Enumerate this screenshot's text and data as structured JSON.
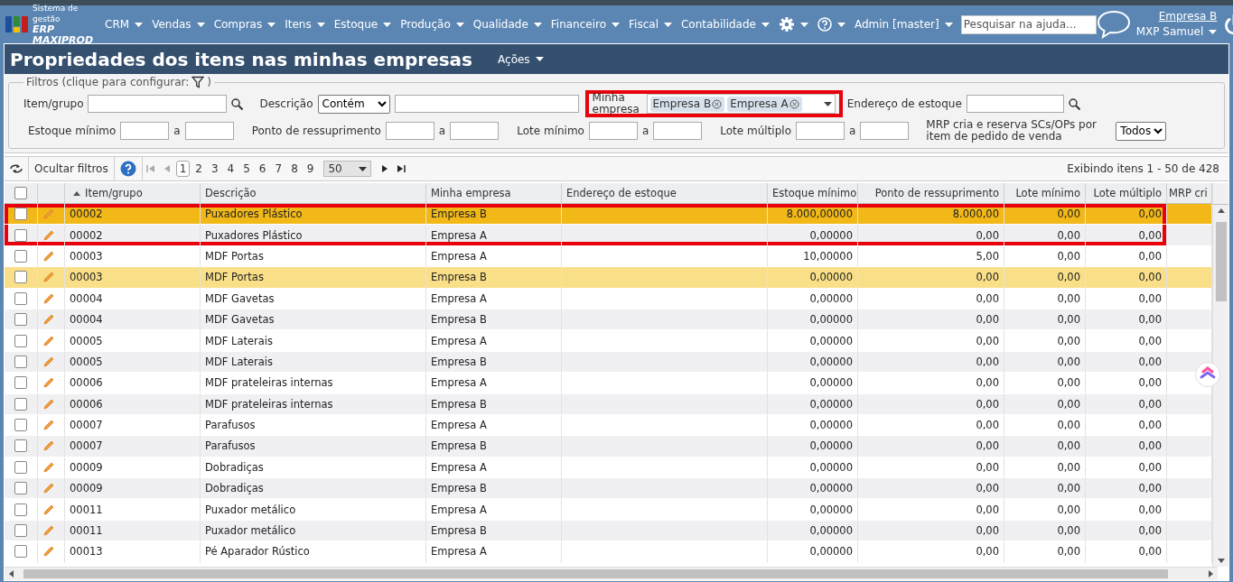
{
  "nav": {
    "logo_line1": "Sistema de gestão",
    "logo_line2": "ERP MAXIPROD",
    "menus": [
      "CRM",
      "Vendas",
      "Compras",
      "Itens",
      "Estoque",
      "Produção",
      "Qualidade",
      "Financeiro",
      "Fiscal",
      "Contabilidade"
    ],
    "user_menu": "Admin [master]",
    "help_search": {
      "placeholder": "Pesquisar na ajuda..."
    },
    "company_link": "Empresa B",
    "user_name": "MXP Samuel"
  },
  "page": {
    "title": "Propriedades dos itens nas minhas empresas",
    "actions": "Ações"
  },
  "filters": {
    "legend": "Filtros (clique para configurar:",
    "legend_end": ")",
    "item_label": "Item/grupo",
    "description_label": "Descrição",
    "description_mode": "Contém",
    "company_label": "Minha empresa",
    "company_tags": [
      "Empresa B",
      "Empresa A"
    ],
    "company_outlined": true,
    "stock_address_label": "Endereço de estoque",
    "ranges": [
      {
        "label": "Estoque mínimo",
        "to": "a"
      },
      {
        "label": "Ponto de ressuprimento",
        "to": "a"
      },
      {
        "label": "Lote mínimo",
        "to": "a"
      },
      {
        "label": "Lote múltiplo",
        "to": "a"
      }
    ],
    "mrp_label": "MRP cria e reserva SCs/OPs por item de pedido de venda",
    "mrp_value": "Todos"
  },
  "toolbar": {
    "hide_filters": "Ocultar filtros",
    "pages": [
      {
        "label": "1",
        "selected": true
      },
      {
        "label": "2",
        "selected": false
      },
      {
        "label": "3",
        "selected": false
      },
      {
        "label": "4",
        "selected": false
      },
      {
        "label": "5",
        "selected": false
      },
      {
        "label": "6",
        "selected": false
      },
      {
        "label": "7",
        "selected": false
      },
      {
        "label": "8",
        "selected": false
      },
      {
        "label": "9",
        "selected": false
      }
    ],
    "page_size": "50",
    "summary": "Exibindo itens 1 - 50 de 428"
  },
  "table": {
    "select_all_checked": false,
    "columns": [
      {
        "label": "Item/grupo",
        "sorted": true
      },
      {
        "label": "Descrição",
        "sorted": false
      },
      {
        "label": "Minha empresa",
        "sorted": false
      },
      {
        "label": "Endereço de estoque",
        "sorted": false
      },
      {
        "label": "Estoque mínimo",
        "sorted": false
      },
      {
        "label": "Ponto de ressuprimento",
        "sorted": false
      },
      {
        "label": "Lote mínimo",
        "sorted": false
      },
      {
        "label": "Lote múltiplo",
        "sorted": false
      },
      {
        "label": "MRP cri",
        "sorted": false
      }
    ],
    "rows": [
      {
        "checked": false,
        "item": "00002",
        "description": "Puxadores Plástico",
        "company": "Empresa B",
        "min_stock": "8.000,00000",
        "reorder_point": "8.000,00",
        "min_lot": "0,00",
        "lot_multiple": "0,00",
        "selected": true,
        "hovered": false,
        "outlined": true
      },
      {
        "checked": false,
        "item": "00002",
        "description": "Puxadores Plástico",
        "company": "Empresa A",
        "min_stock": "0,00000",
        "reorder_point": "0,00",
        "min_lot": "0,00",
        "lot_multiple": "0,00",
        "selected": false,
        "hovered": false,
        "outlined": true
      },
      {
        "checked": false,
        "item": "00003",
        "description": "MDF Portas",
        "company": "Empresa A",
        "min_stock": "10,00000",
        "reorder_point": "5,00",
        "min_lot": "0,00",
        "lot_multiple": "0,00",
        "selected": false,
        "hovered": false,
        "outlined": false
      },
      {
        "checked": false,
        "item": "00003",
        "description": "MDF Portas",
        "company": "Empresa B",
        "min_stock": "0,00000",
        "reorder_point": "0,00",
        "min_lot": "0,00",
        "lot_multiple": "0,00",
        "selected": false,
        "hovered": true,
        "outlined": false
      },
      {
        "checked": false,
        "item": "00004",
        "description": "MDF Gavetas",
        "company": "Empresa A",
        "min_stock": "0,00000",
        "reorder_point": "0,00",
        "min_lot": "0,00",
        "lot_multiple": "0,00",
        "selected": false,
        "hovered": false,
        "outlined": false
      },
      {
        "checked": false,
        "item": "00004",
        "description": "MDF Gavetas",
        "company": "Empresa B",
        "min_stock": "0,00000",
        "reorder_point": "0,00",
        "min_lot": "0,00",
        "lot_multiple": "0,00",
        "selected": false,
        "hovered": false,
        "outlined": false
      },
      {
        "checked": false,
        "item": "00005",
        "description": "MDF Laterais",
        "company": "Empresa A",
        "min_stock": "0,00000",
        "reorder_point": "0,00",
        "min_lot": "0,00",
        "lot_multiple": "0,00",
        "selected": false,
        "hovered": false,
        "outlined": false
      },
      {
        "checked": false,
        "item": "00005",
        "description": "MDF Laterais",
        "company": "Empresa B",
        "min_stock": "0,00000",
        "reorder_point": "0,00",
        "min_lot": "0,00",
        "lot_multiple": "0,00",
        "selected": false,
        "hovered": false,
        "outlined": false
      },
      {
        "checked": false,
        "item": "00006",
        "description": "MDF prateleiras internas",
        "company": "Empresa A",
        "min_stock": "0,00000",
        "reorder_point": "0,00",
        "min_lot": "0,00",
        "lot_multiple": "0,00",
        "selected": false,
        "hovered": false,
        "outlined": false
      },
      {
        "checked": false,
        "item": "00006",
        "description": "MDF prateleiras internas",
        "company": "Empresa B",
        "min_stock": "0,00000",
        "reorder_point": "0,00",
        "min_lot": "0,00",
        "lot_multiple": "0,00",
        "selected": false,
        "hovered": false,
        "outlined": false
      },
      {
        "checked": false,
        "item": "00007",
        "description": "Parafusos",
        "company": "Empresa A",
        "min_stock": "0,00000",
        "reorder_point": "0,00",
        "min_lot": "0,00",
        "lot_multiple": "0,00",
        "selected": false,
        "hovered": false,
        "outlined": false
      },
      {
        "checked": false,
        "item": "00007",
        "description": "Parafusos",
        "company": "Empresa B",
        "min_stock": "0,00000",
        "reorder_point": "0,00",
        "min_lot": "0,00",
        "lot_multiple": "0,00",
        "selected": false,
        "hovered": false,
        "outlined": false
      },
      {
        "checked": false,
        "item": "00009",
        "description": "Dobradiças",
        "company": "Empresa A",
        "min_stock": "0,00000",
        "reorder_point": "0,00",
        "min_lot": "0,00",
        "lot_multiple": "0,00",
        "selected": false,
        "hovered": false,
        "outlined": false
      },
      {
        "checked": false,
        "item": "00009",
        "description": "Dobradiças",
        "company": "Empresa B",
        "min_stock": "0,00000",
        "reorder_point": "0,00",
        "min_lot": "0,00",
        "lot_multiple": "0,00",
        "selected": false,
        "hovered": false,
        "outlined": false
      },
      {
        "checked": false,
        "item": "00011",
        "description": "Puxador metálico",
        "company": "Empresa A",
        "min_stock": "0,00000",
        "reorder_point": "0,00",
        "min_lot": "0,00",
        "lot_multiple": "0,00",
        "selected": false,
        "hovered": false,
        "outlined": false
      },
      {
        "checked": false,
        "item": "00011",
        "description": "Puxador metálico",
        "company": "Empresa B",
        "min_stock": "0,00000",
        "reorder_point": "0,00",
        "min_lot": "0,00",
        "lot_multiple": "0,00",
        "selected": false,
        "hovered": false,
        "outlined": false
      },
      {
        "checked": false,
        "item": "00013",
        "description": "Pé Aparador Rústico",
        "company": "Empresa A",
        "min_stock": "0,00000",
        "reorder_point": "0,00",
        "min_lot": "0,00",
        "lot_multiple": "0,00",
        "selected": false,
        "hovered": false,
        "outlined": false
      }
    ]
  }
}
